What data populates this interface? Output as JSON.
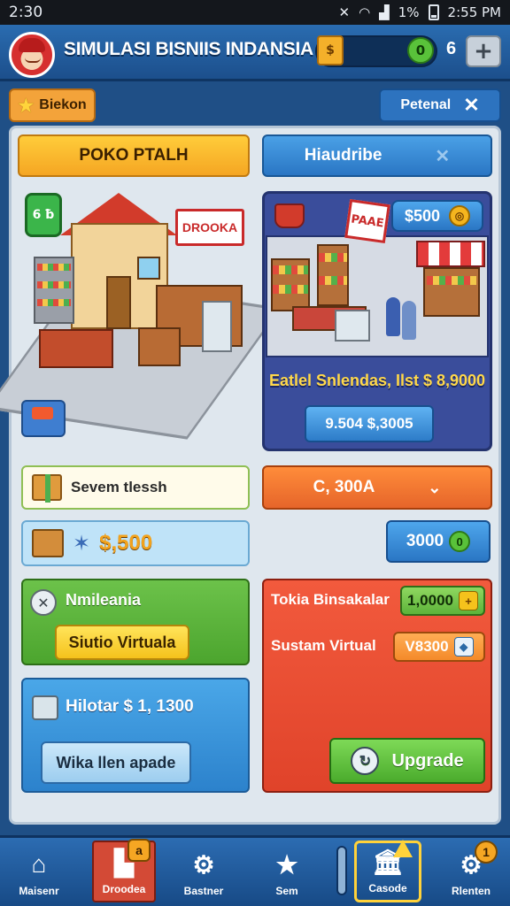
{
  "status_bar": {
    "time_left": "2:30",
    "battery": "1%",
    "time_right": "2:55 PM"
  },
  "header": {
    "title": "SIMULASI BISNIIS INDANSIA",
    "gems": "6",
    "plus_label": "+",
    "coin_glyph": "$",
    "gem_glyph": "0"
  },
  "tabs": {
    "left_label": "Biekon",
    "right_label": "Petenal"
  },
  "section_buttons": {
    "left": "POKO PTALH",
    "right": "Hiaudribe"
  },
  "shop_sign": "DROOKA",
  "shop_badge": "6 ƀ",
  "market": {
    "price": "$500",
    "sign": "PAAE",
    "title": "Eatlel Snlendas, Ilst $ 8,9000",
    "button": "9.504 $,3005"
  },
  "row1": {
    "left_label": "Sevem tlessh",
    "dropdown": "C, 300A"
  },
  "row2": {
    "left_amount": "$,500",
    "right_amount": "3000"
  },
  "green_card": {
    "label": "Nmileania",
    "button": "Siutio Virtuala"
  },
  "blue_card": {
    "label": "Hilotar $ 1, 1300",
    "button": "Wika llen apade"
  },
  "red_card": {
    "label1": "Tokia Binsakalar",
    "value1": "1,0000",
    "label2": "Sustam Virtual",
    "value2": "V8300",
    "button": "Upgrade"
  },
  "nav": {
    "items": [
      {
        "label": "Maisenr"
      },
      {
        "label": "Droodea",
        "badge": "a"
      },
      {
        "label": "Bastner"
      },
      {
        "label": "Sem"
      },
      {
        "label": "Casode"
      },
      {
        "label": "Rlenten",
        "badge": "1"
      }
    ]
  },
  "colors": {
    "accent_blue": "#2a76c4",
    "accent_orange": "#f5a623",
    "accent_red": "#e0432a",
    "accent_green": "#4ca52e"
  }
}
